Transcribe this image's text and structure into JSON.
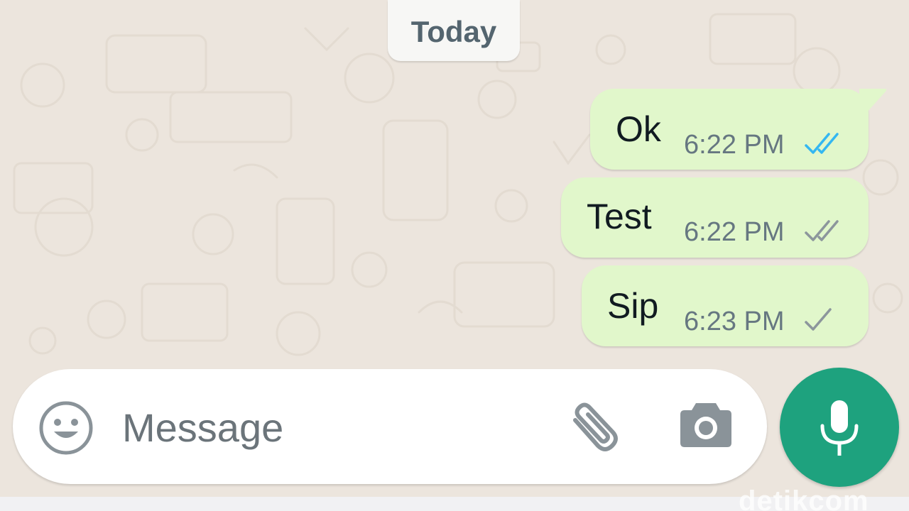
{
  "chat": {
    "date_divider": "Today",
    "messages": [
      {
        "text": "Ok",
        "time": "6:22 PM",
        "status": "read",
        "status_icon": "double-check-blue-icon"
      },
      {
        "text": "Test",
        "time": "6:22 PM",
        "status": "delivered",
        "status_icon": "double-check-grey-icon"
      },
      {
        "text": "Sip",
        "time": "6:23 PM",
        "status": "sent",
        "status_icon": "single-check-grey-icon"
      }
    ]
  },
  "composer": {
    "placeholder": "Message",
    "icons": [
      "emoji-icon",
      "attachment-icon",
      "camera-icon",
      "microphone-icon"
    ]
  },
  "watermark": "detikcom",
  "colors": {
    "background": "#ece5dd",
    "outgoing_bubble": "#e1f7cb",
    "read_tick": "#34b7f1",
    "grey_tick": "#8c969c",
    "mic_button": "#1ea27e",
    "time_text": "#667781"
  }
}
